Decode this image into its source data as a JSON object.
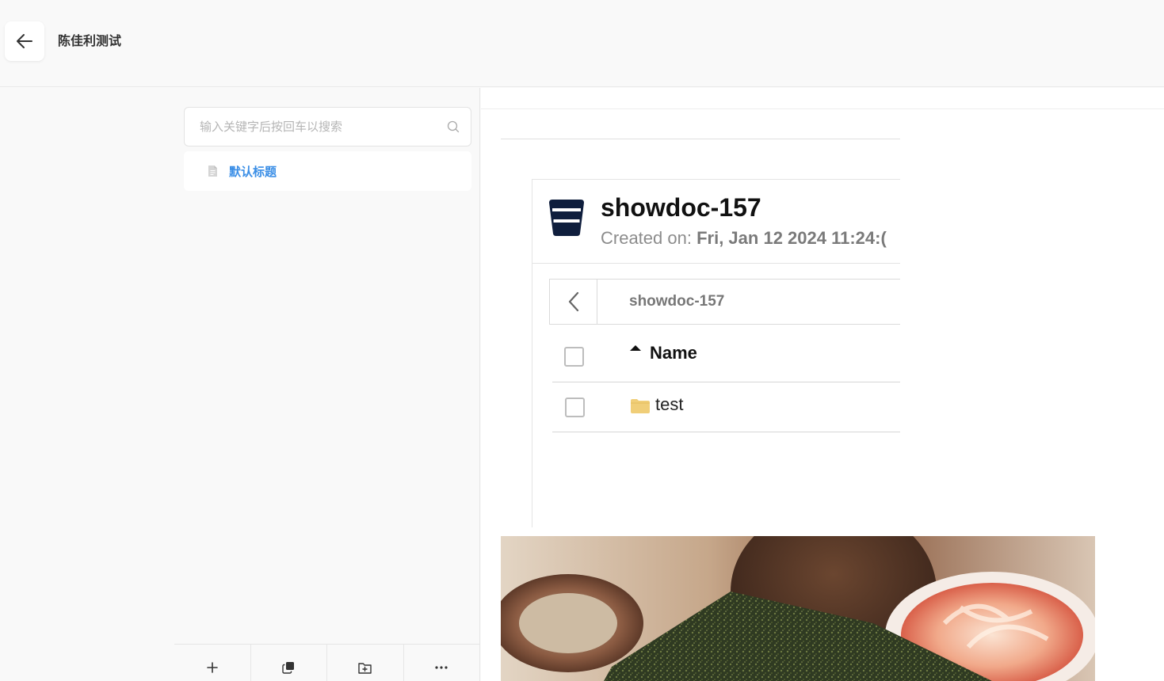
{
  "header": {
    "project_title": "陈佳利测试"
  },
  "sidebar": {
    "search": {
      "placeholder": "输入关键字后按回车以搜索",
      "value": ""
    },
    "pages": [
      {
        "label": "默认标题"
      }
    ],
    "toolbar": [
      {
        "icon": "plus-icon"
      },
      {
        "icon": "copy-icon"
      },
      {
        "icon": "folder-add-icon"
      },
      {
        "icon": "more-icon"
      }
    ]
  },
  "content": {
    "screenshot": {
      "title": "showdoc-157",
      "created_label": "Created on:",
      "created_value": "Fri, Jan 12 2024 11:24:(",
      "path": "showdoc-157",
      "column_name": "Name",
      "rows": [
        {
          "name": "test",
          "icon": "folder-icon"
        }
      ]
    },
    "photo": {
      "icon": "food-photo"
    }
  },
  "colors": {
    "link": "#3a8ee6",
    "folder": "#f0ce78",
    "logo": "#0f1e3d"
  }
}
